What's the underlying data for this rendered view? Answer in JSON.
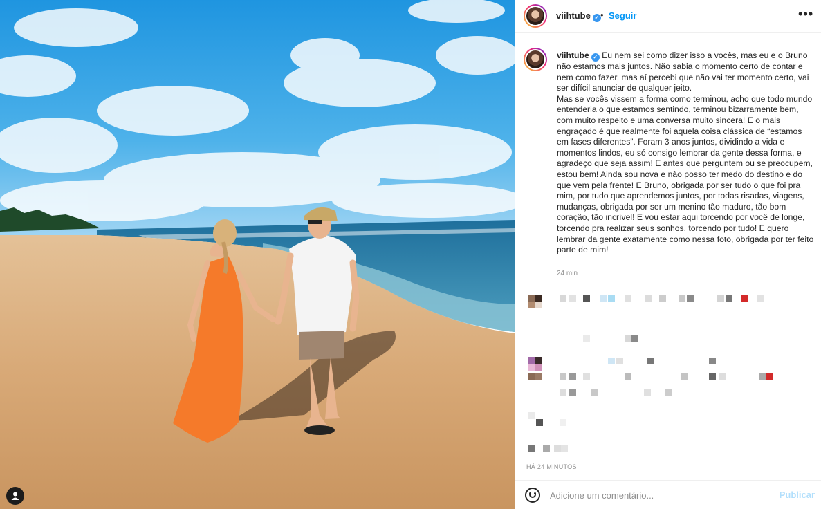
{
  "post": {
    "username": "viihtube",
    "verified_icon": "verified-badge-icon",
    "separator": "•",
    "follow_label": "Seguir",
    "more_icon": "ellipsis-icon",
    "more_label": "•••",
    "caption": "Eu nem sei como dizer isso a vocês, mas eu e o Bruno não estamos mais juntos. Não sabia o momento certo de contar e nem como fazer, mas aí percebi que não vai ter momento certo, vai ser difícil anunciar de qualquer jeito.\nMas se vocês vissem a forma como terminou, acho que todo mundo entenderia o que estamos sentindo, terminou bizarramente bem, com muito respeito e uma conversa muito sincera! E o mais engraçado é que realmente foi aquela coisa clássica de “estamos em fases diferentes”. Foram 3 anos juntos, dividindo a vida e momentos lindos, eu só consigo lembrar da gente dessa forma, e agradeço que seja assim! E antes que perguntem ou se preocupem, estou bem! Ainda sou nova e não posso ter medo do destino e do que vem pela frente! E Bruno, obrigada por ser tudo o que foi pra mim, por tudo que aprendemos juntos, por todas risadas, viagens, mudanças, obrigada por ser um menino tão maduro, tão bom coração, tão incrível! E vou estar aqui torcendo por você de longe, torcendo pra realizar seus sonhos, torcendo por tudo! E quero lembrar da gente exatamente como nessa foto, obrigada por ter feito parte de mim!",
    "caption_time": "24 min",
    "posted_ago": "HÁ 24 MINUTOS"
  },
  "comment_box": {
    "emoji_icon": "smiley-icon",
    "placeholder": "Adicione um comentário...",
    "publish_label": "Publicar"
  },
  "photo": {
    "description_icon": "user-tag-icon",
    "sky_color": "#3aa3e6",
    "sand_color": "#d9ad7c",
    "sea_color": "#2f7ea8",
    "dress_color": "#f57a2a"
  },
  "redacted": {
    "note_icon": "pixelated-comments"
  }
}
